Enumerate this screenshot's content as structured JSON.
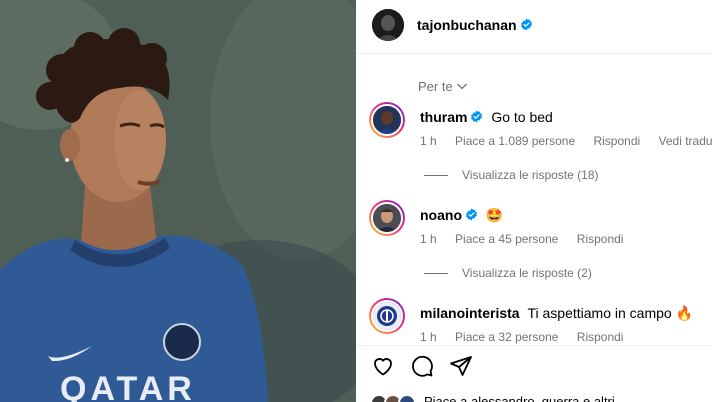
{
  "post": {
    "author": "tajonbuchanan",
    "photo": {
      "jersey_text": "QATAR"
    }
  },
  "comments_section": {
    "sort_label": "Per te",
    "comments": [
      {
        "username": "thuram",
        "verified": true,
        "text": "Go to bed",
        "time": "1 h",
        "likes": "Piace a 1.089 persone",
        "reply": "Rispondi",
        "translate": "Vedi traduzione",
        "view_replies": "Visualizza le risposte (18)"
      },
      {
        "username": "noano",
        "verified": true,
        "text": "🤩",
        "time": "1 h",
        "likes": "Piace a 45 persone",
        "reply": "Rispondi",
        "view_replies": "Visualizza le risposte (2)"
      },
      {
        "username": "milanointerista",
        "verified": false,
        "text": "Ti aspettiamo in campo 🔥",
        "time": "1 h",
        "likes": "Piace a 32 persone",
        "reply": "Rispondi"
      }
    ]
  },
  "action_bar": {
    "icons": [
      "heart-icon",
      "comment-icon",
      "share-icon"
    ]
  },
  "likes_summary": {
    "text": "Piace a alessandro_guerra e altri"
  },
  "colors": {
    "verified_blue": "#0095f6",
    "muted_text": "#737373",
    "story_ring_start": "#f9ce34",
    "story_ring_end": "#6228d7"
  }
}
